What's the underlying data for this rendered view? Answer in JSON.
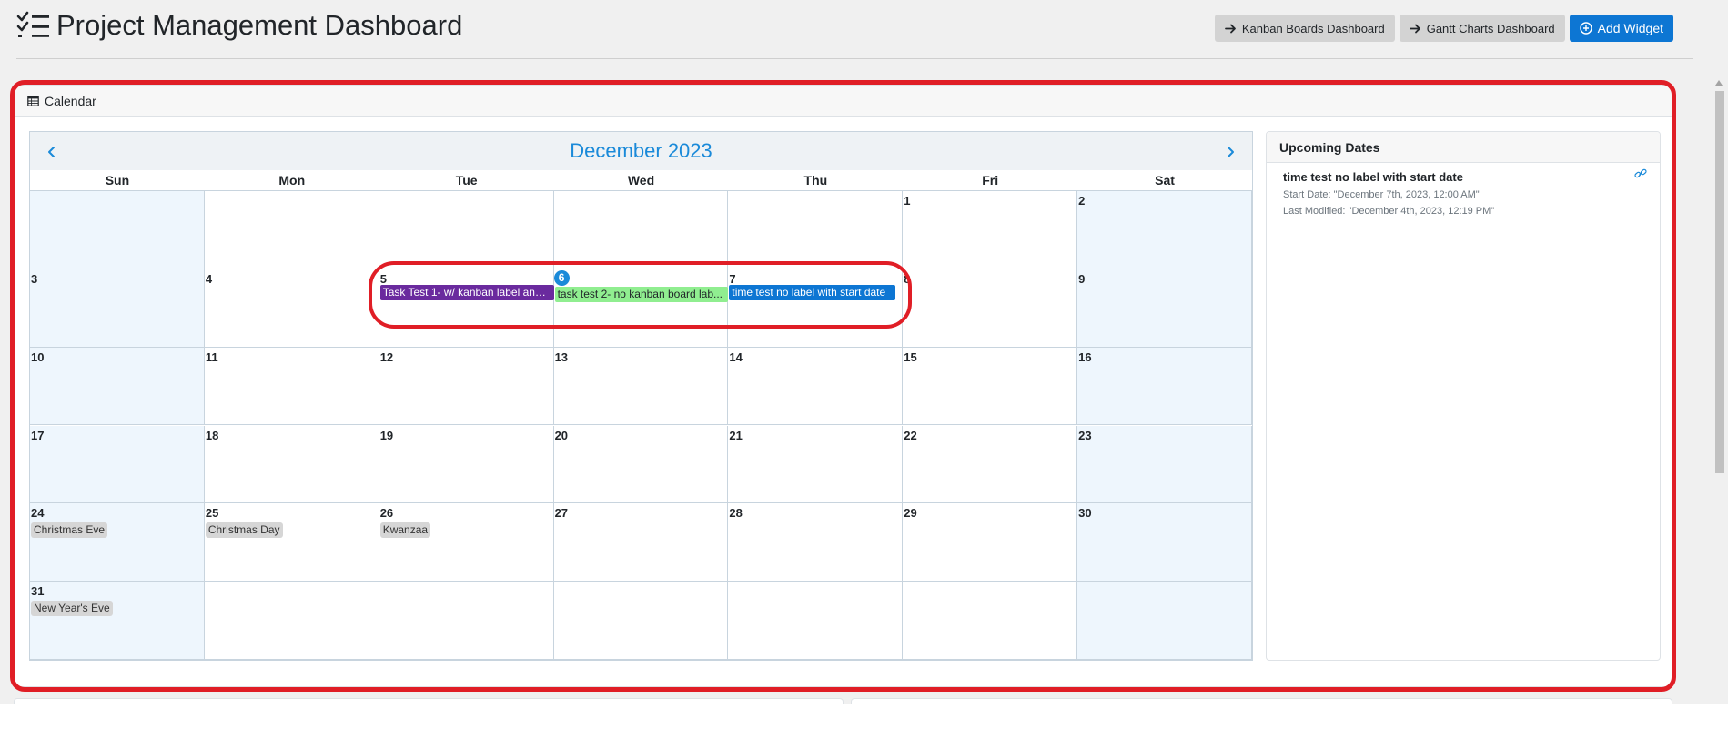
{
  "header": {
    "title": "Project Management Dashboard",
    "icon": "checklist-icon",
    "buttons": {
      "kanban": "Kanban Boards Dashboard",
      "gantt": "Gantt Charts Dashboard",
      "add_widget": "Add Widget"
    }
  },
  "widget": {
    "title": "Calendar",
    "icon": "calendar-icon"
  },
  "calendar": {
    "month_label": "December 2023",
    "weekdays": [
      "Sun",
      "Mon",
      "Tue",
      "Wed",
      "Thu",
      "Fri",
      "Sat"
    ],
    "today": "6",
    "weeks": [
      [
        "",
        "",
        "",
        "",
        "",
        "1",
        "2"
      ],
      [
        "3",
        "4",
        "5",
        "6",
        "7",
        "8",
        "9"
      ],
      [
        "10",
        "11",
        "12",
        "13",
        "14",
        "15",
        "16"
      ],
      [
        "17",
        "18",
        "19",
        "20",
        "21",
        "22",
        "23"
      ],
      [
        "24",
        "25",
        "26",
        "27",
        "28",
        "29",
        "30"
      ],
      [
        "31",
        "",
        "",
        "",
        "",
        "",
        ""
      ]
    ],
    "holidays": [
      {
        "week": 4,
        "day": 0,
        "label": "Christmas Eve"
      },
      {
        "week": 4,
        "day": 1,
        "label": "Christmas Day"
      },
      {
        "week": 4,
        "day": 2,
        "label": "Kwanzaa"
      },
      {
        "week": 5,
        "day": 0,
        "label": "New Year's Eve"
      }
    ],
    "events": [
      {
        "week": 1,
        "day": 2,
        "label": "Task Test 1- w/ kanban label and ...",
        "color": "#6a2a9e",
        "text_color": "#ffffff"
      },
      {
        "week": 1,
        "day": 3,
        "label": "task test 2- no kanban board lab...",
        "color": "#90ee90",
        "text_color": "#212529"
      },
      {
        "week": 1,
        "day": 4,
        "label": "time test no label with start date",
        "color": "#0d76d3",
        "text_color": "#ffffff"
      }
    ],
    "colors": {
      "accent": "#1a8ad9",
      "weekend_bg": "#eef6fd",
      "grid_line": "#c8d4de"
    }
  },
  "upcoming": {
    "title": "Upcoming Dates",
    "items": [
      {
        "title": "time test no label with start date",
        "start": "Start Date: \"December 7th, 2023, 12:00 AM\"",
        "modified": "Last Modified: \"December 4th, 2023, 12:19 PM\""
      }
    ]
  },
  "annotation_color": "#e01e26"
}
